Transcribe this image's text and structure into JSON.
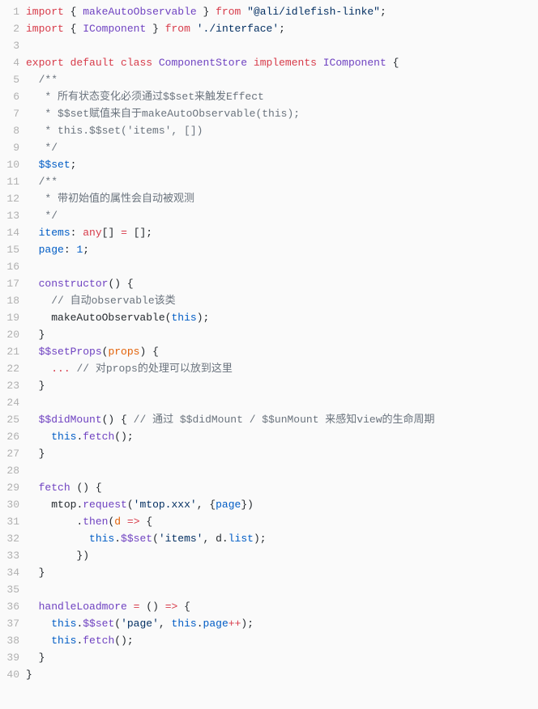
{
  "chart_data": null,
  "code": {
    "lines": [
      {
        "n": 1,
        "tokens": [
          [
            "k-import",
            "import"
          ],
          [
            "",
            " "
          ],
          [
            "brace",
            "{"
          ],
          [
            "",
            " "
          ],
          [
            "fn-name",
            "makeAutoObservable"
          ],
          [
            "",
            " "
          ],
          [
            "brace",
            "}"
          ],
          [
            "",
            " "
          ],
          [
            "k-from",
            "from"
          ],
          [
            "",
            " "
          ],
          [
            "str",
            "\"@ali/idlefish-linke\""
          ],
          [
            "punct",
            ";"
          ]
        ]
      },
      {
        "n": 2,
        "tokens": [
          [
            "k-import",
            "import"
          ],
          [
            "",
            " "
          ],
          [
            "brace",
            "{"
          ],
          [
            "",
            " "
          ],
          [
            "type-name",
            "IComponent"
          ],
          [
            "",
            " "
          ],
          [
            "brace",
            "}"
          ],
          [
            "",
            " "
          ],
          [
            "k-from",
            "from"
          ],
          [
            "",
            " "
          ],
          [
            "str",
            "'./interface'"
          ],
          [
            "punct",
            ";"
          ]
        ]
      },
      {
        "n": 3,
        "tokens": []
      },
      {
        "n": 4,
        "tokens": [
          [
            "k-export",
            "export"
          ],
          [
            "",
            " "
          ],
          [
            "k-default",
            "default"
          ],
          [
            "",
            " "
          ],
          [
            "k-class",
            "class"
          ],
          [
            "",
            " "
          ],
          [
            "cls-name",
            "ComponentStore"
          ],
          [
            "",
            " "
          ],
          [
            "k-implements",
            "implements"
          ],
          [
            "",
            " "
          ],
          [
            "type-name",
            "IComponent"
          ],
          [
            "",
            " "
          ],
          [
            "brace",
            "{"
          ]
        ]
      },
      {
        "n": 5,
        "tokens": [
          [
            "",
            "  "
          ],
          [
            "comment",
            "/**"
          ]
        ]
      },
      {
        "n": 6,
        "tokens": [
          [
            "",
            "  "
          ],
          [
            "comment",
            " * 所有状态变化必须通过$$set来触发Effect"
          ]
        ]
      },
      {
        "n": 7,
        "tokens": [
          [
            "",
            "  "
          ],
          [
            "comment",
            " * $$set赋值来自于makeAutoObservable(this);"
          ]
        ]
      },
      {
        "n": 8,
        "tokens": [
          [
            "",
            "  "
          ],
          [
            "comment",
            " * this.$$set('items', [])"
          ]
        ]
      },
      {
        "n": 9,
        "tokens": [
          [
            "",
            "  "
          ],
          [
            "comment",
            " */"
          ]
        ]
      },
      {
        "n": 10,
        "tokens": [
          [
            "",
            "  "
          ],
          [
            "prop",
            "$$set"
          ],
          [
            "punct",
            ";"
          ]
        ]
      },
      {
        "n": 11,
        "tokens": [
          [
            "",
            "  "
          ],
          [
            "comment",
            "/**"
          ]
        ]
      },
      {
        "n": 12,
        "tokens": [
          [
            "",
            "  "
          ],
          [
            "comment",
            " * 带初始值的属性会自动被观测"
          ]
        ]
      },
      {
        "n": 13,
        "tokens": [
          [
            "",
            "  "
          ],
          [
            "comment",
            " */"
          ]
        ]
      },
      {
        "n": 14,
        "tokens": [
          [
            "",
            "  "
          ],
          [
            "prop",
            "items"
          ],
          [
            "punct",
            ":"
          ],
          [
            "",
            " "
          ],
          [
            "k-any",
            "any"
          ],
          [
            "punct",
            "[]"
          ],
          [
            "",
            " "
          ],
          [
            "k-eq",
            "="
          ],
          [
            "",
            " "
          ],
          [
            "punct",
            "[];"
          ]
        ]
      },
      {
        "n": 15,
        "tokens": [
          [
            "",
            "  "
          ],
          [
            "prop",
            "page"
          ],
          [
            "punct",
            ":"
          ],
          [
            "",
            " "
          ],
          [
            "num",
            "1"
          ],
          [
            "punct",
            ";"
          ]
        ]
      },
      {
        "n": 16,
        "tokens": []
      },
      {
        "n": 17,
        "tokens": [
          [
            "",
            "  "
          ],
          [
            "fn-name",
            "constructor"
          ],
          [
            "paren",
            "()"
          ],
          [
            "",
            " "
          ],
          [
            "brace",
            "{"
          ]
        ]
      },
      {
        "n": 18,
        "tokens": [
          [
            "",
            "    "
          ],
          [
            "comment",
            "// 自动observable该类"
          ]
        ]
      },
      {
        "n": 19,
        "tokens": [
          [
            "",
            "    "
          ],
          [
            "",
            "makeAutoObservable"
          ],
          [
            "paren",
            "("
          ],
          [
            "k-this",
            "this"
          ],
          [
            "paren",
            ")"
          ],
          [
            "punct",
            ";"
          ]
        ]
      },
      {
        "n": 20,
        "tokens": [
          [
            "",
            "  "
          ],
          [
            "brace",
            "}"
          ]
        ]
      },
      {
        "n": 21,
        "tokens": [
          [
            "",
            "  "
          ],
          [
            "fn-name",
            "$$setProps"
          ],
          [
            "paren",
            "("
          ],
          [
            "param",
            "props"
          ],
          [
            "paren",
            ")"
          ],
          [
            "",
            " "
          ],
          [
            "brace",
            "{"
          ]
        ]
      },
      {
        "n": 22,
        "tokens": [
          [
            "",
            "    "
          ],
          [
            "spread",
            "..."
          ],
          [
            "",
            " "
          ],
          [
            "comment",
            "// 对props的处理可以放到这里"
          ]
        ]
      },
      {
        "n": 23,
        "tokens": [
          [
            "",
            "  "
          ],
          [
            "brace",
            "}"
          ]
        ]
      },
      {
        "n": 24,
        "tokens": []
      },
      {
        "n": 25,
        "tokens": [
          [
            "",
            "  "
          ],
          [
            "fn-name",
            "$$didMount"
          ],
          [
            "paren",
            "()"
          ],
          [
            "",
            " "
          ],
          [
            "brace",
            "{"
          ],
          [
            "",
            " "
          ],
          [
            "comment",
            "// 通过 $$didMount / $$unMount 来感知view的生命周期"
          ]
        ]
      },
      {
        "n": 26,
        "tokens": [
          [
            "",
            "    "
          ],
          [
            "k-this",
            "this"
          ],
          [
            "punct",
            "."
          ],
          [
            "fn-name",
            "fetch"
          ],
          [
            "paren",
            "()"
          ],
          [
            "punct",
            ";"
          ]
        ]
      },
      {
        "n": 27,
        "tokens": [
          [
            "",
            "  "
          ],
          [
            "brace",
            "}"
          ]
        ]
      },
      {
        "n": 28,
        "tokens": []
      },
      {
        "n": 29,
        "tokens": [
          [
            "",
            "  "
          ],
          [
            "fn-name",
            "fetch"
          ],
          [
            "",
            " "
          ],
          [
            "paren",
            "()"
          ],
          [
            "",
            " "
          ],
          [
            "brace",
            "{"
          ]
        ]
      },
      {
        "n": 30,
        "tokens": [
          [
            "",
            "    "
          ],
          [
            "",
            "mtop"
          ],
          [
            "punct",
            "."
          ],
          [
            "fn-name",
            "request"
          ],
          [
            "paren",
            "("
          ],
          [
            "str",
            "'mtop.xxx'"
          ],
          [
            "punct",
            ","
          ],
          [
            "",
            " "
          ],
          [
            "brace",
            "{"
          ],
          [
            "prop",
            "page"
          ],
          [
            "brace",
            "}"
          ],
          [
            "paren",
            ")"
          ]
        ]
      },
      {
        "n": 31,
        "tokens": [
          [
            "",
            "        "
          ],
          [
            "punct",
            "."
          ],
          [
            "fn-name",
            "then"
          ],
          [
            "paren",
            "("
          ],
          [
            "param",
            "d"
          ],
          [
            "",
            " "
          ],
          [
            "k-arrow",
            "=>"
          ],
          [
            "",
            " "
          ],
          [
            "brace",
            "{"
          ]
        ]
      },
      {
        "n": 32,
        "tokens": [
          [
            "",
            "          "
          ],
          [
            "k-this",
            "this"
          ],
          [
            "punct",
            "."
          ],
          [
            "fn-name",
            "$$set"
          ],
          [
            "paren",
            "("
          ],
          [
            "str",
            "'items'"
          ],
          [
            "punct",
            ","
          ],
          [
            "",
            " "
          ],
          [
            "",
            "d"
          ],
          [
            "punct",
            "."
          ],
          [
            "prop",
            "list"
          ],
          [
            "paren",
            ")"
          ],
          [
            "punct",
            ";"
          ]
        ]
      },
      {
        "n": 33,
        "tokens": [
          [
            "",
            "        "
          ],
          [
            "brace",
            "}"
          ],
          [
            "paren",
            ")"
          ]
        ]
      },
      {
        "n": 34,
        "tokens": [
          [
            "",
            "  "
          ],
          [
            "brace",
            "}"
          ]
        ]
      },
      {
        "n": 35,
        "tokens": []
      },
      {
        "n": 36,
        "tokens": [
          [
            "",
            "  "
          ],
          [
            "fn-name",
            "handleLoadmore"
          ],
          [
            "",
            " "
          ],
          [
            "k-eq",
            "="
          ],
          [
            "",
            " "
          ],
          [
            "paren",
            "()"
          ],
          [
            "",
            " "
          ],
          [
            "k-arrow",
            "=>"
          ],
          [
            "",
            " "
          ],
          [
            "brace",
            "{"
          ]
        ]
      },
      {
        "n": 37,
        "tokens": [
          [
            "",
            "    "
          ],
          [
            "k-this",
            "this"
          ],
          [
            "punct",
            "."
          ],
          [
            "fn-name",
            "$$set"
          ],
          [
            "paren",
            "("
          ],
          [
            "str",
            "'page'"
          ],
          [
            "punct",
            ","
          ],
          [
            "",
            " "
          ],
          [
            "k-this",
            "this"
          ],
          [
            "punct",
            "."
          ],
          [
            "prop",
            "page"
          ],
          [
            "k-op",
            "++"
          ],
          [
            "paren",
            ")"
          ],
          [
            "punct",
            ";"
          ]
        ]
      },
      {
        "n": 38,
        "tokens": [
          [
            "",
            "    "
          ],
          [
            "k-this",
            "this"
          ],
          [
            "punct",
            "."
          ],
          [
            "fn-name",
            "fetch"
          ],
          [
            "paren",
            "()"
          ],
          [
            "punct",
            ";"
          ]
        ]
      },
      {
        "n": 39,
        "tokens": [
          [
            "",
            "  "
          ],
          [
            "brace",
            "}"
          ]
        ]
      },
      {
        "n": 40,
        "tokens": [
          [
            "brace",
            "}"
          ]
        ]
      }
    ]
  }
}
